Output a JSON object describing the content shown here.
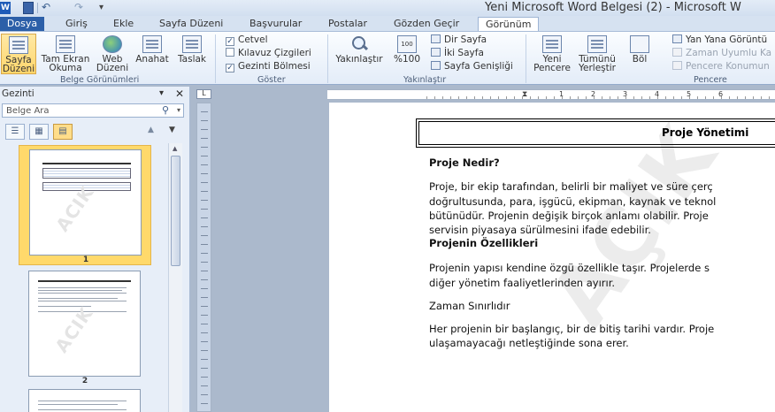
{
  "window": {
    "title": "Yeni Microsoft Word Belgesi (2) - Microsoft W"
  },
  "qat": {
    "word_logo": "W",
    "more": "▾"
  },
  "tabs": [
    {
      "label": "Dosya"
    },
    {
      "label": "Giriş"
    },
    {
      "label": "Ekle"
    },
    {
      "label": "Sayfa Düzeni"
    },
    {
      "label": "Başvurular"
    },
    {
      "label": "Postalar"
    },
    {
      "label": "Gözden Geçir"
    },
    {
      "label": "Görünüm"
    }
  ],
  "ribbon": {
    "groups": {
      "belge": "Belge Görünümleri",
      "goster": "Göster",
      "yakinlastir": "Yakınlaştır",
      "pencere": "Pencere"
    },
    "belge_buttons": [
      {
        "line1": "Sayfa",
        "line2": "Düzeni"
      },
      {
        "line1": "Tam Ekran",
        "line2": "Okuma"
      },
      {
        "line1": "Web",
        "line2": "Düzeni"
      },
      {
        "line1": "Anahat",
        "line2": ""
      },
      {
        "line1": "Taslak",
        "line2": ""
      }
    ],
    "show_checks": [
      {
        "label": "Cetvel",
        "checked": "✓"
      },
      {
        "label": "Kılavuz Çizgileri",
        "checked": ""
      },
      {
        "label": "Gezinti Bölmesi",
        "checked": "✓"
      }
    ],
    "zoom": {
      "zoom_label": "Yakınlaştır",
      "percent_icon": "100",
      "percent_label": "%100",
      "one_page": "Dir Sayfa",
      "two_pages": "İki Sayfa",
      "page_width": "Sayfa Genişliği"
    },
    "window_buttons": {
      "new_window": {
        "line1": "Yeni",
        "line2": "Pencere"
      },
      "arrange_all": {
        "line1": "Tümünü",
        "line2": "Yerleştir"
      },
      "split": {
        "line1": "Böl",
        "line2": ""
      },
      "side_by_side": "Yan Yana Görüntü",
      "sync_scroll": "Zaman Uyumlu Ka",
      "reset_position": "Pencere Konumun"
    }
  },
  "nav": {
    "title": "Gezinti",
    "dropdown": "▾",
    "close": "✕",
    "search_placeholder": "Belge Ara",
    "search_icon": "⚲",
    "search_drop": "▾",
    "tabs": [
      "☰",
      "▦",
      "▤"
    ],
    "up": "▲",
    "down": "▼",
    "thumbnails": [
      {
        "page": "1",
        "watermark": "ACIK"
      },
      {
        "page": "2",
        "watermark": "ACIK"
      }
    ]
  },
  "ruler": {
    "corner": "L",
    "marks": [
      "1",
      "2",
      "3",
      "4",
      "5",
      "6"
    ]
  },
  "document": {
    "watermark": "AÇIK",
    "title": "Proje Yönetimi",
    "paragraphs": [
      {
        "text": "Proje Nedir?",
        "bold": true
      },
      {
        "text": "Proje, bir ekip tarafından, belirli bir maliyet ve süre çerç",
        "bold": false
      },
      {
        "text": "doğrultusunda, para, işgücü, ekipman, kaynak ve teknol",
        "bold": false
      },
      {
        "text": "bütünüdür.  Projenin değişik birçok anlamı olabilir. Proje",
        "bold": false
      },
      {
        "text": "servisin piyasaya sürülmesini ifade edebilir.",
        "bold": false
      },
      {
        "text": "Projenin Özellikleri",
        "bold": true
      },
      {
        "text": "Projenin yapısı kendine özgü özellikle taşır. Projelerde s",
        "bold": false
      },
      {
        "text": "diğer yönetim faaliyetlerinden ayırır.",
        "bold": false
      },
      {
        "text": "Zaman Sınırlıdır",
        "bold": false
      },
      {
        "text": "Her projenin bir başlangıç, bir de bitiş tarihi vardır. Proje",
        "bold": false
      },
      {
        "text": "ulaşamayacağı netleştiğinde sona erer.",
        "bold": false
      }
    ]
  }
}
